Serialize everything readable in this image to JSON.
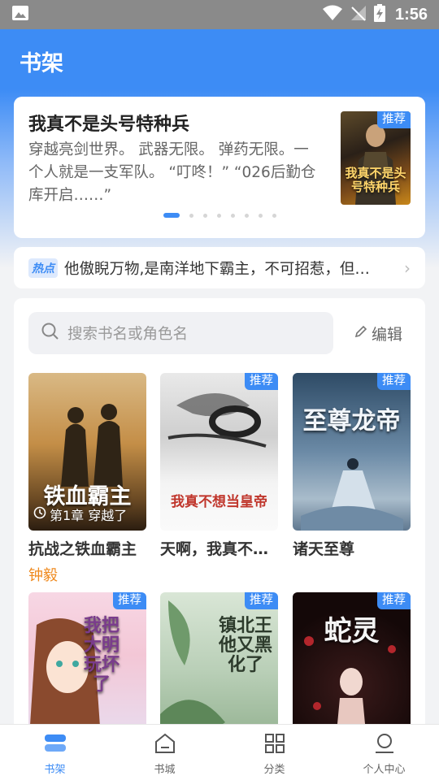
{
  "status_bar": {
    "time": "1:56"
  },
  "header": {
    "title": "书架"
  },
  "featured": {
    "title": "我真不是头号特种兵",
    "description": "穿越亮剑世界。 武器无限。 弹药无限。一个人就是一支军队。 “叮咚！” “026后勤仓库开启……”",
    "badge": "推荐",
    "cover_text": "我真不是头号特种兵",
    "carousel_pages": 8,
    "carousel_active": 0
  },
  "hot": {
    "tag": "热点",
    "text": "他傲睨万物,是南洋地下霸主，不可招惹，但…"
  },
  "shelf": {
    "search_placeholder": "搜索书名或角色名",
    "edit_label": "编辑",
    "books": [
      {
        "name": "抗战之铁血霸主",
        "author": "钟毅",
        "progress": "第1章 穿越了",
        "cover_text": "铁血霸主",
        "badge": ""
      },
      {
        "name": "天啊，我真不…",
        "author": "",
        "progress": "",
        "cover_text": "我真不想当皇帝",
        "badge": "推荐"
      },
      {
        "name": "诸天至尊",
        "author": "",
        "progress": "",
        "cover_text": "至尊龙帝",
        "badge": "推荐"
      },
      {
        "name": "",
        "author": "",
        "progress": "",
        "cover_text": "我把大明玩坏了",
        "badge": "推荐"
      },
      {
        "name": "",
        "author": "",
        "progress": "",
        "cover_text": "镇北王他又黑化了",
        "badge": "推荐"
      },
      {
        "name": "",
        "author": "",
        "progress": "",
        "cover_text": "蛇灵",
        "badge": "推荐"
      }
    ]
  },
  "bottom_nav": [
    {
      "label": "书架",
      "icon": "bookshelf-icon",
      "active": true
    },
    {
      "label": "书城",
      "icon": "bookstore-icon",
      "active": false
    },
    {
      "label": "分类",
      "icon": "category-icon",
      "active": false
    },
    {
      "label": "个人中心",
      "icon": "profile-icon",
      "active": false
    }
  ],
  "colors": {
    "accent": "#3d8cf5",
    "author": "#ef8a1f"
  }
}
